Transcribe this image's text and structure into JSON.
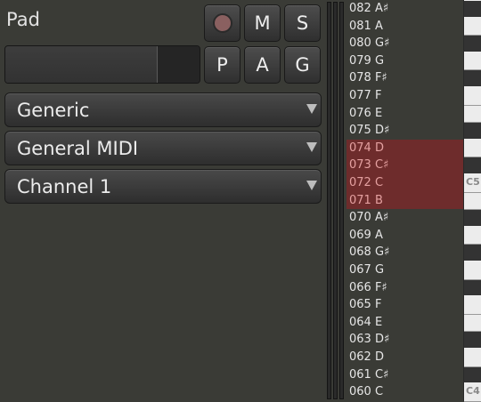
{
  "track": {
    "name": "Pad"
  },
  "buttons": {
    "record_icon": "record-icon",
    "mute": "M",
    "solo": "S",
    "playlist": "P",
    "automation": "A",
    "group": "G"
  },
  "dropdowns": {
    "instrument": "Generic",
    "midi_standard": "General MIDI",
    "channel": "Channel  1"
  },
  "fader": {
    "level": 0.78
  },
  "notes": [
    {
      "label": "082 A♯",
      "selected": false
    },
    {
      "label": "081 A",
      "selected": false
    },
    {
      "label": "080 G♯",
      "selected": false
    },
    {
      "label": "079 G",
      "selected": false
    },
    {
      "label": "078 F♯",
      "selected": false
    },
    {
      "label": "077 F",
      "selected": false
    },
    {
      "label": "076 E",
      "selected": false
    },
    {
      "label": "075 D♯",
      "selected": false
    },
    {
      "label": "074 D",
      "selected": true
    },
    {
      "label": "073 C♯",
      "selected": true
    },
    {
      "label": "072 C",
      "selected": true
    },
    {
      "label": "071 B",
      "selected": true
    },
    {
      "label": "070 A♯",
      "selected": false
    },
    {
      "label": "069 A",
      "selected": false
    },
    {
      "label": "068 G♯",
      "selected": false
    },
    {
      "label": "067 G",
      "selected": false
    },
    {
      "label": "066 F♯",
      "selected": false
    },
    {
      "label": "065 F",
      "selected": false
    },
    {
      "label": "064 E",
      "selected": false
    },
    {
      "label": "063 D♯",
      "selected": false
    },
    {
      "label": "062 D",
      "selected": false
    },
    {
      "label": "061 C♯",
      "selected": false
    },
    {
      "label": "060 C",
      "selected": false
    }
  ],
  "keyboard": {
    "octave_labels": [
      "C5",
      "C4"
    ]
  },
  "colors": {
    "selection": "#6e2c2c",
    "selection_text": "#e4a0a0",
    "background": "#3a3b36"
  }
}
